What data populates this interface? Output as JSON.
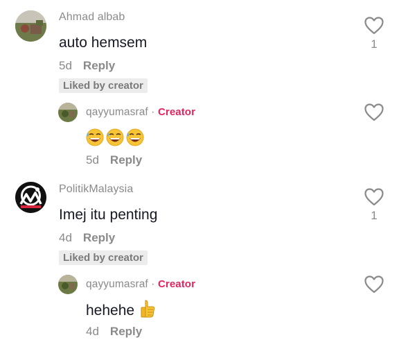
{
  "comments": [
    {
      "username": "Ahmad albab",
      "text": "auto hemsem",
      "age": "5d",
      "reply_label": "Reply",
      "badge": "Liked by creator",
      "likes": "1",
      "reply": {
        "username": "qayyumasraf",
        "separator": "·",
        "creator_label": "Creator",
        "emojis": [
          "grinning-sweat-face",
          "grinning-sweat-face",
          "grinning-sweat-face"
        ],
        "age": "5d",
        "reply_label": "Reply"
      }
    },
    {
      "username": "PolitikMalaysia",
      "text": "Imej itu penting",
      "age": "4d",
      "reply_label": "Reply",
      "badge": "Liked by creator",
      "likes": "1",
      "reply": {
        "username": "qayyumasraf",
        "separator": "·",
        "creator_label": "Creator",
        "text": "hehehe",
        "emoji": "thumbs-up",
        "age": "4d",
        "reply_label": "Reply"
      }
    }
  ],
  "colors": {
    "creator": "#e0245e",
    "muted": "#8a8a8a",
    "text": "#161823",
    "badge_bg": "#ececec"
  }
}
